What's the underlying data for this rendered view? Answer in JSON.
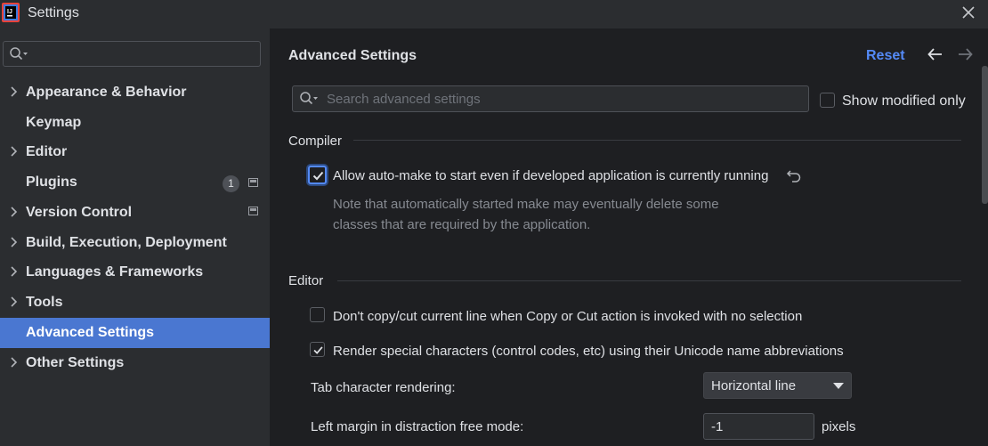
{
  "window": {
    "title": "Settings"
  },
  "sidebar": {
    "search_placeholder": "",
    "items": [
      {
        "label": "Appearance & Behavior",
        "expandable": true
      },
      {
        "label": "Keymap",
        "expandable": false
      },
      {
        "label": "Editor",
        "expandable": true
      },
      {
        "label": "Plugins",
        "expandable": false,
        "badge": "1"
      },
      {
        "label": "Version Control",
        "expandable": true
      },
      {
        "label": "Build, Execution, Deployment",
        "expandable": true
      },
      {
        "label": "Languages & Frameworks",
        "expandable": true
      },
      {
        "label": "Tools",
        "expandable": true
      },
      {
        "label": "Advanced Settings",
        "expandable": false,
        "selected": true
      },
      {
        "label": "Other Settings",
        "expandable": true
      }
    ]
  },
  "main": {
    "title": "Advanced Settings",
    "reset_label": "Reset",
    "search_placeholder": "Search advanced settings",
    "show_modified_label": "Show modified only",
    "show_modified_checked": false,
    "sections": {
      "compiler": {
        "title": "Compiler",
        "option_label": "Allow auto-make to start even if developed application is currently running",
        "option_checked": true,
        "note_line1": "Note that automatically started make may eventually delete some",
        "note_line2": "classes that are required by the application."
      },
      "editor": {
        "title": "Editor",
        "copy_cut_label": "Don't copy/cut current line when Copy or Cut action is invoked with no selection",
        "copy_cut_checked": false,
        "render_special_label": "Render special characters (control codes, etc) using their Unicode name abbreviations",
        "render_special_checked": true,
        "tab_rendering_label": "Tab character rendering:",
        "tab_rendering_value": "Horizontal line",
        "left_margin_label": "Left margin in distraction free mode:",
        "left_margin_value": "-1",
        "left_margin_suffix": "pixels"
      }
    }
  },
  "colors": {
    "accent": "#548af7",
    "selection": "#4a77d1",
    "sidebar_bg": "#2b2d30",
    "content_bg": "#1e1f22"
  },
  "icons": [
    "app-logo-icon",
    "close-icon",
    "search-icon",
    "chevron-right-icon",
    "back-arrow-icon",
    "forward-arrow-icon",
    "revert-icon",
    "dropdown-arrow-icon",
    "project-level-icon"
  ]
}
